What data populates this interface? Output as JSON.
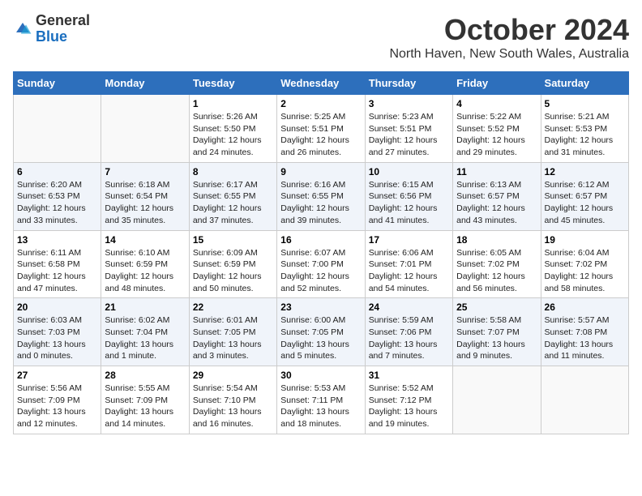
{
  "logo": {
    "general": "General",
    "blue": "Blue"
  },
  "title": "October 2024",
  "subtitle": "North Haven, New South Wales, Australia",
  "weekdays": [
    "Sunday",
    "Monday",
    "Tuesday",
    "Wednesday",
    "Thursday",
    "Friday",
    "Saturday"
  ],
  "weeks": [
    [
      {
        "day": null
      },
      {
        "day": null
      },
      {
        "day": "1",
        "sunrise": "Sunrise: 5:26 AM",
        "sunset": "Sunset: 5:50 PM",
        "daylight": "Daylight: 12 hours and 24 minutes."
      },
      {
        "day": "2",
        "sunrise": "Sunrise: 5:25 AM",
        "sunset": "Sunset: 5:51 PM",
        "daylight": "Daylight: 12 hours and 26 minutes."
      },
      {
        "day": "3",
        "sunrise": "Sunrise: 5:23 AM",
        "sunset": "Sunset: 5:51 PM",
        "daylight": "Daylight: 12 hours and 27 minutes."
      },
      {
        "day": "4",
        "sunrise": "Sunrise: 5:22 AM",
        "sunset": "Sunset: 5:52 PM",
        "daylight": "Daylight: 12 hours and 29 minutes."
      },
      {
        "day": "5",
        "sunrise": "Sunrise: 5:21 AM",
        "sunset": "Sunset: 5:53 PM",
        "daylight": "Daylight: 12 hours and 31 minutes."
      }
    ],
    [
      {
        "day": "6",
        "sunrise": "Sunrise: 6:20 AM",
        "sunset": "Sunset: 6:53 PM",
        "daylight": "Daylight: 12 hours and 33 minutes."
      },
      {
        "day": "7",
        "sunrise": "Sunrise: 6:18 AM",
        "sunset": "Sunset: 6:54 PM",
        "daylight": "Daylight: 12 hours and 35 minutes."
      },
      {
        "day": "8",
        "sunrise": "Sunrise: 6:17 AM",
        "sunset": "Sunset: 6:55 PM",
        "daylight": "Daylight: 12 hours and 37 minutes."
      },
      {
        "day": "9",
        "sunrise": "Sunrise: 6:16 AM",
        "sunset": "Sunset: 6:55 PM",
        "daylight": "Daylight: 12 hours and 39 minutes."
      },
      {
        "day": "10",
        "sunrise": "Sunrise: 6:15 AM",
        "sunset": "Sunset: 6:56 PM",
        "daylight": "Daylight: 12 hours and 41 minutes."
      },
      {
        "day": "11",
        "sunrise": "Sunrise: 6:13 AM",
        "sunset": "Sunset: 6:57 PM",
        "daylight": "Daylight: 12 hours and 43 minutes."
      },
      {
        "day": "12",
        "sunrise": "Sunrise: 6:12 AM",
        "sunset": "Sunset: 6:57 PM",
        "daylight": "Daylight: 12 hours and 45 minutes."
      }
    ],
    [
      {
        "day": "13",
        "sunrise": "Sunrise: 6:11 AM",
        "sunset": "Sunset: 6:58 PM",
        "daylight": "Daylight: 12 hours and 47 minutes."
      },
      {
        "day": "14",
        "sunrise": "Sunrise: 6:10 AM",
        "sunset": "Sunset: 6:59 PM",
        "daylight": "Daylight: 12 hours and 48 minutes."
      },
      {
        "day": "15",
        "sunrise": "Sunrise: 6:09 AM",
        "sunset": "Sunset: 6:59 PM",
        "daylight": "Daylight: 12 hours and 50 minutes."
      },
      {
        "day": "16",
        "sunrise": "Sunrise: 6:07 AM",
        "sunset": "Sunset: 7:00 PM",
        "daylight": "Daylight: 12 hours and 52 minutes."
      },
      {
        "day": "17",
        "sunrise": "Sunrise: 6:06 AM",
        "sunset": "Sunset: 7:01 PM",
        "daylight": "Daylight: 12 hours and 54 minutes."
      },
      {
        "day": "18",
        "sunrise": "Sunrise: 6:05 AM",
        "sunset": "Sunset: 7:02 PM",
        "daylight": "Daylight: 12 hours and 56 minutes."
      },
      {
        "day": "19",
        "sunrise": "Sunrise: 6:04 AM",
        "sunset": "Sunset: 7:02 PM",
        "daylight": "Daylight: 12 hours and 58 minutes."
      }
    ],
    [
      {
        "day": "20",
        "sunrise": "Sunrise: 6:03 AM",
        "sunset": "Sunset: 7:03 PM",
        "daylight": "Daylight: 13 hours and 0 minutes."
      },
      {
        "day": "21",
        "sunrise": "Sunrise: 6:02 AM",
        "sunset": "Sunset: 7:04 PM",
        "daylight": "Daylight: 13 hours and 1 minute."
      },
      {
        "day": "22",
        "sunrise": "Sunrise: 6:01 AM",
        "sunset": "Sunset: 7:05 PM",
        "daylight": "Daylight: 13 hours and 3 minutes."
      },
      {
        "day": "23",
        "sunrise": "Sunrise: 6:00 AM",
        "sunset": "Sunset: 7:05 PM",
        "daylight": "Daylight: 13 hours and 5 minutes."
      },
      {
        "day": "24",
        "sunrise": "Sunrise: 5:59 AM",
        "sunset": "Sunset: 7:06 PM",
        "daylight": "Daylight: 13 hours and 7 minutes."
      },
      {
        "day": "25",
        "sunrise": "Sunrise: 5:58 AM",
        "sunset": "Sunset: 7:07 PM",
        "daylight": "Daylight: 13 hours and 9 minutes."
      },
      {
        "day": "26",
        "sunrise": "Sunrise: 5:57 AM",
        "sunset": "Sunset: 7:08 PM",
        "daylight": "Daylight: 13 hours and 11 minutes."
      }
    ],
    [
      {
        "day": "27",
        "sunrise": "Sunrise: 5:56 AM",
        "sunset": "Sunset: 7:09 PM",
        "daylight": "Daylight: 13 hours and 12 minutes."
      },
      {
        "day": "28",
        "sunrise": "Sunrise: 5:55 AM",
        "sunset": "Sunset: 7:09 PM",
        "daylight": "Daylight: 13 hours and 14 minutes."
      },
      {
        "day": "29",
        "sunrise": "Sunrise: 5:54 AM",
        "sunset": "Sunset: 7:10 PM",
        "daylight": "Daylight: 13 hours and 16 minutes."
      },
      {
        "day": "30",
        "sunrise": "Sunrise: 5:53 AM",
        "sunset": "Sunset: 7:11 PM",
        "daylight": "Daylight: 13 hours and 18 minutes."
      },
      {
        "day": "31",
        "sunrise": "Sunrise: 5:52 AM",
        "sunset": "Sunset: 7:12 PM",
        "daylight": "Daylight: 13 hours and 19 minutes."
      },
      {
        "day": null
      },
      {
        "day": null
      }
    ]
  ]
}
